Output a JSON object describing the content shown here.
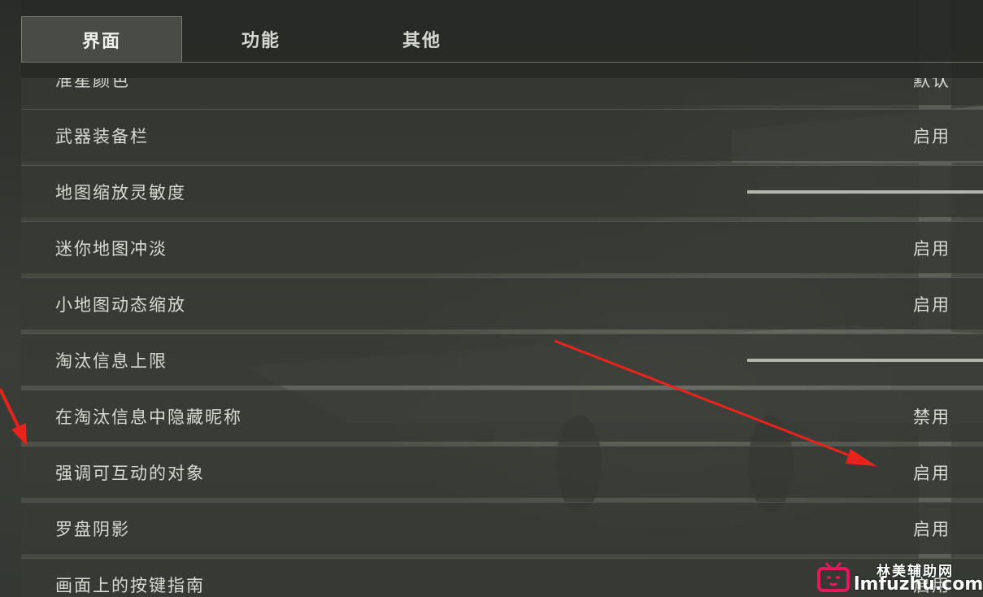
{
  "tabs": [
    {
      "label": "界面",
      "active": true
    },
    {
      "label": "功能",
      "active": false
    },
    {
      "label": "其他",
      "active": false
    }
  ],
  "settings": [
    {
      "label": "准星颜色",
      "value": "默认"
    },
    {
      "label": "武器装备栏",
      "value": "启用"
    },
    {
      "label": "地图缩放灵敏度",
      "value": null,
      "slider_level": 1.0
    },
    {
      "label": "迷你地图冲淡",
      "value": "启用"
    },
    {
      "label": "小地图动态缩放",
      "value": "启用"
    },
    {
      "label": "淘汰信息上限",
      "value": null,
      "slider_level": 1.0
    },
    {
      "label": "在淘汰信息中隐藏昵称",
      "value": "禁用"
    },
    {
      "label": "强调可互动的对象",
      "value": "启用"
    },
    {
      "label": "罗盘阴影",
      "value": "启用"
    },
    {
      "label": "画面上的按键指南",
      "value": "启用"
    }
  ],
  "watermark": {
    "name": "林美辅助网",
    "domain": "lmfuzhu.com",
    "icon": "tv-icon"
  },
  "colors": {
    "annotation_arrow": "#e8231c",
    "watermark_icon": "#e5175f"
  }
}
